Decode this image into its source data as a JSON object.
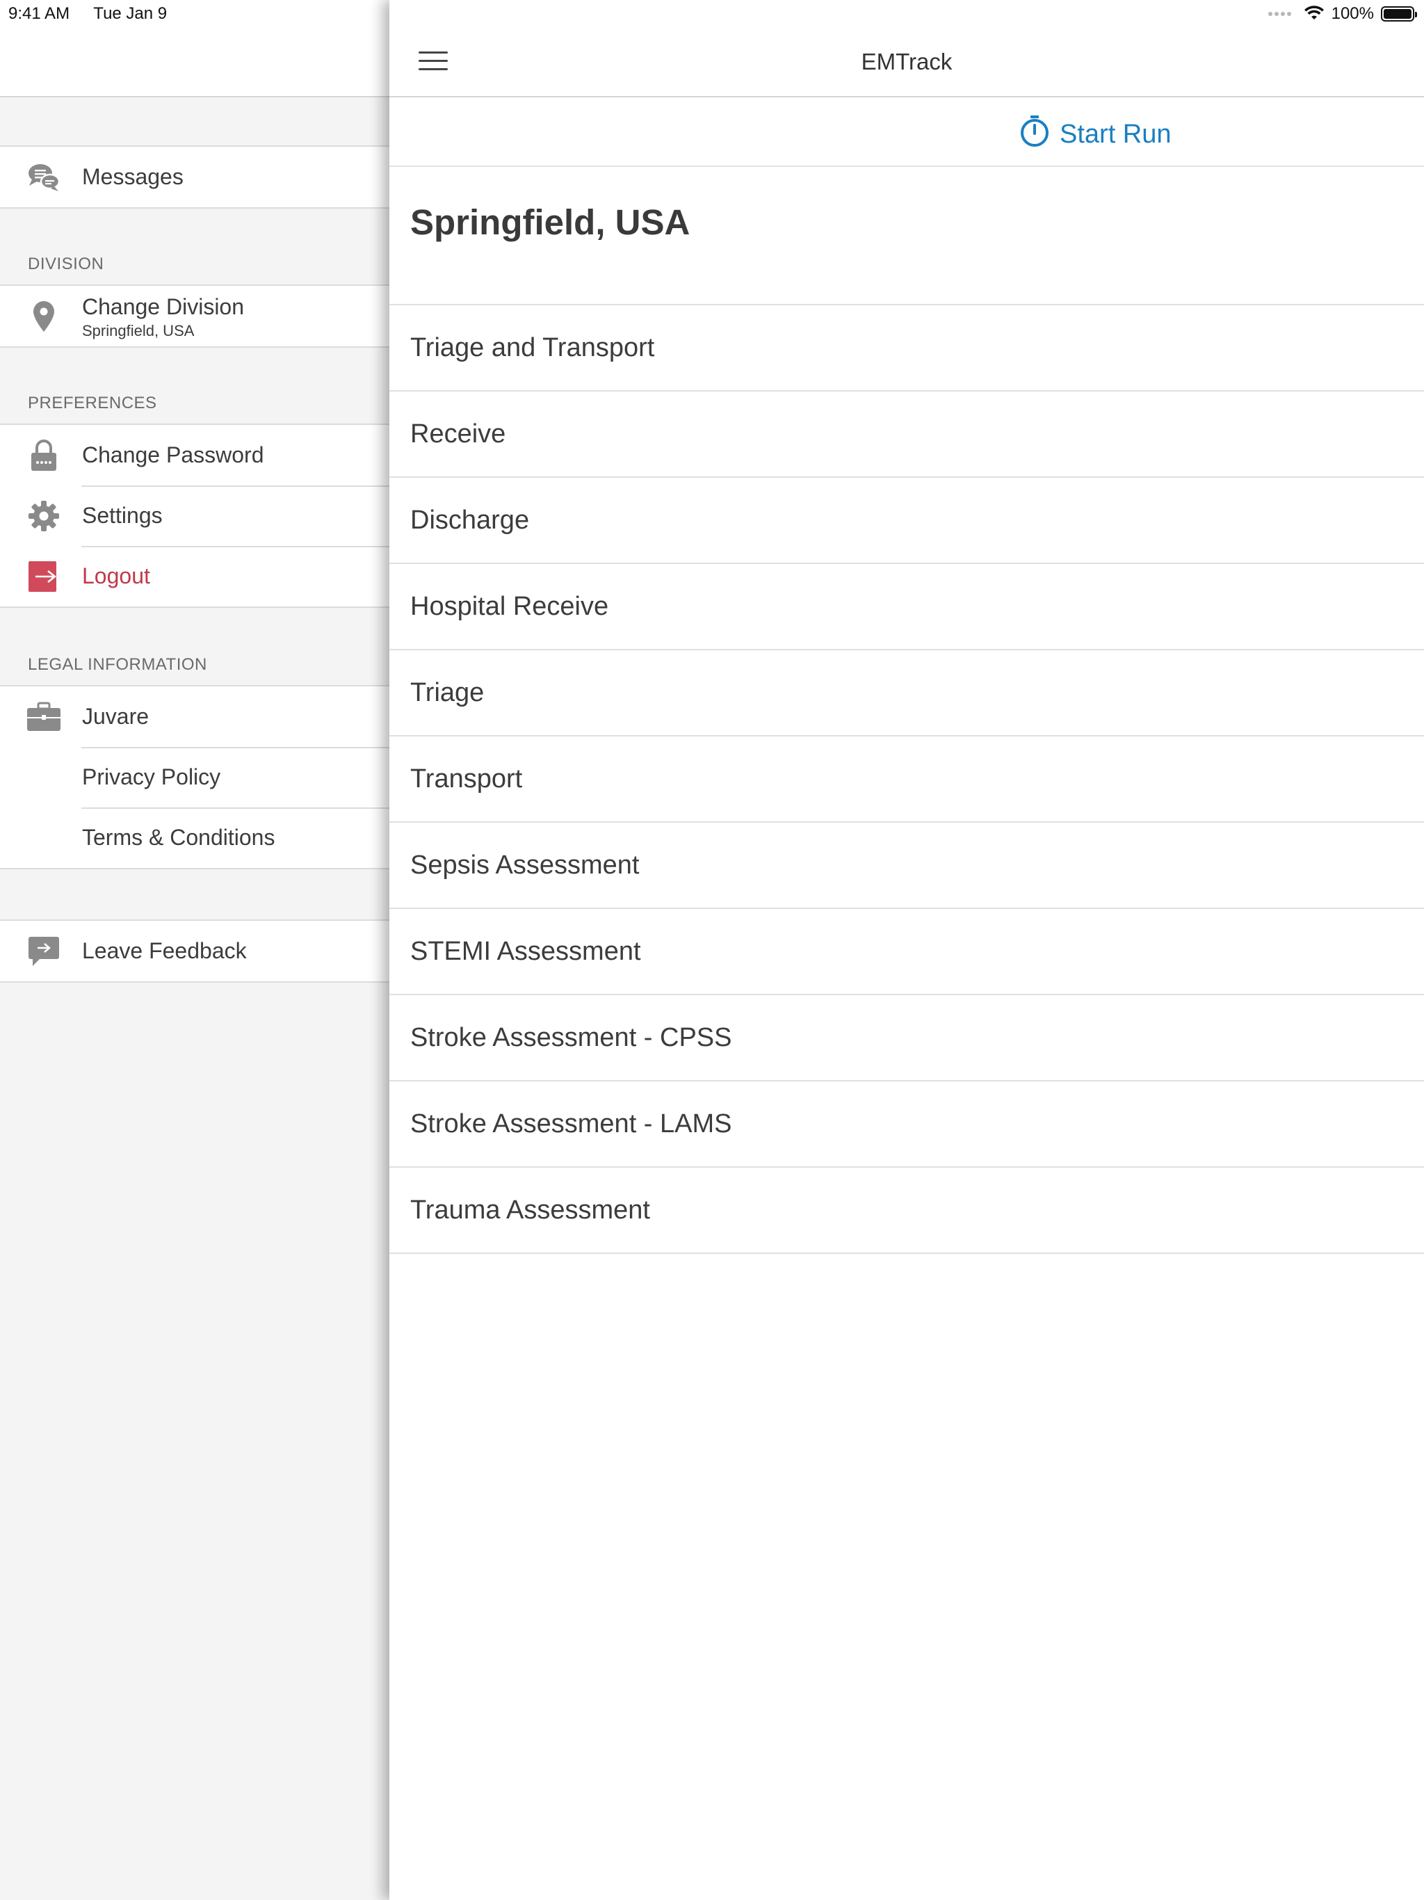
{
  "status_bar": {
    "time": "9:41 AM",
    "date": "Tue Jan 9",
    "battery": "100%",
    "battery_level": 1.0
  },
  "side_menu": {
    "messages": {
      "label": "Messages",
      "icon": "chat-bubbles-icon"
    },
    "division_section": "DIVISION",
    "change_division": {
      "label": "Change Division",
      "sub": "Springfield, USA",
      "icon": "map-pin-icon"
    },
    "preferences_section": "PREFERENCES",
    "change_password": {
      "label": "Change Password",
      "icon": "lock-icon"
    },
    "settings": {
      "label": "Settings",
      "icon": "gear-icon"
    },
    "logout": {
      "label": "Logout",
      "icon": "logout-icon",
      "color": "#c0394b"
    },
    "legal_section": "LEGAL INFORMATION",
    "juvare": {
      "label": "Juvare",
      "icon": "briefcase-icon"
    },
    "privacy_policy": {
      "label": "Privacy Policy"
    },
    "terms": {
      "label": "Terms & Conditions"
    },
    "leave_feedback": {
      "label": "Leave Feedback",
      "icon": "feedback-icon"
    }
  },
  "main": {
    "title": "EMTrack",
    "menu_icon": "hamburger-icon",
    "start_run": {
      "label": "Start Run",
      "icon": "stopwatch-icon",
      "color": "#1a7fc1"
    },
    "division_title": "Springfield, USA",
    "forms": [
      "Triage and Transport",
      "Receive",
      "Discharge",
      "Hospital Receive",
      "Triage",
      "Transport",
      "Sepsis Assessment",
      "STEMI Assessment",
      "Stroke Assessment - CPSS",
      "Stroke Assessment - LAMS",
      "Trauma Assessment"
    ]
  }
}
